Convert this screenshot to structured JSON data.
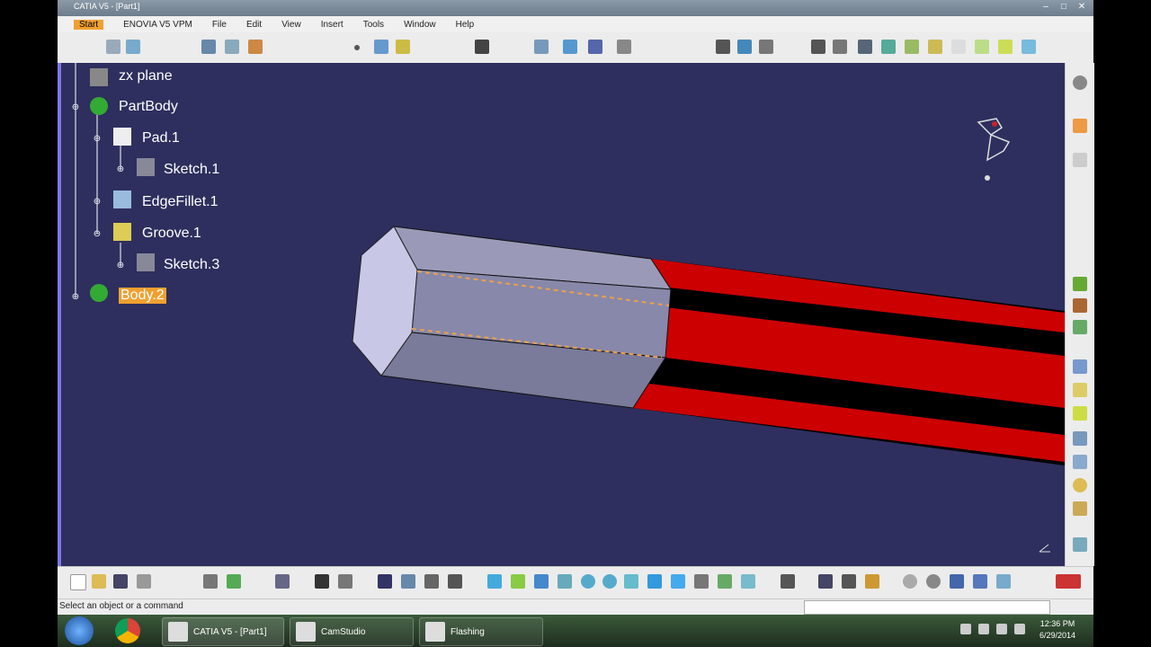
{
  "window": {
    "title": "CATIA V5 - [Part1]",
    "controls": [
      "–",
      "□",
      "✕"
    ]
  },
  "menubar": {
    "items": [
      "Start",
      "ENOVIA V5 VPM",
      "File",
      "Edit",
      "View",
      "Insert",
      "Tools",
      "Window",
      "Help"
    ]
  },
  "tree": {
    "items": [
      {
        "label": "zx plane"
      },
      {
        "label": "PartBody"
      },
      {
        "label": "Pad.1"
      },
      {
        "label": "Sketch.1"
      },
      {
        "label": "EdgeFillet.1"
      },
      {
        "label": "Groove.1"
      },
      {
        "label": "Sketch.3"
      },
      {
        "label": "Body.2"
      }
    ]
  },
  "status": {
    "message": "Select an object or a command"
  },
  "taskbar": {
    "buttons": [
      {
        "label": "CATIA V5 - [Part1]"
      },
      {
        "label": "CamStudio"
      },
      {
        "label": "Flashing"
      }
    ],
    "time": "12:36 PM",
    "date": "6/29/2014"
  },
  "colors": {
    "viewport_bg": "#2e2f5e",
    "selected_bg": "#f0a030",
    "stripe_red": "#cc0000",
    "hex_face": "#c8c8e6"
  }
}
